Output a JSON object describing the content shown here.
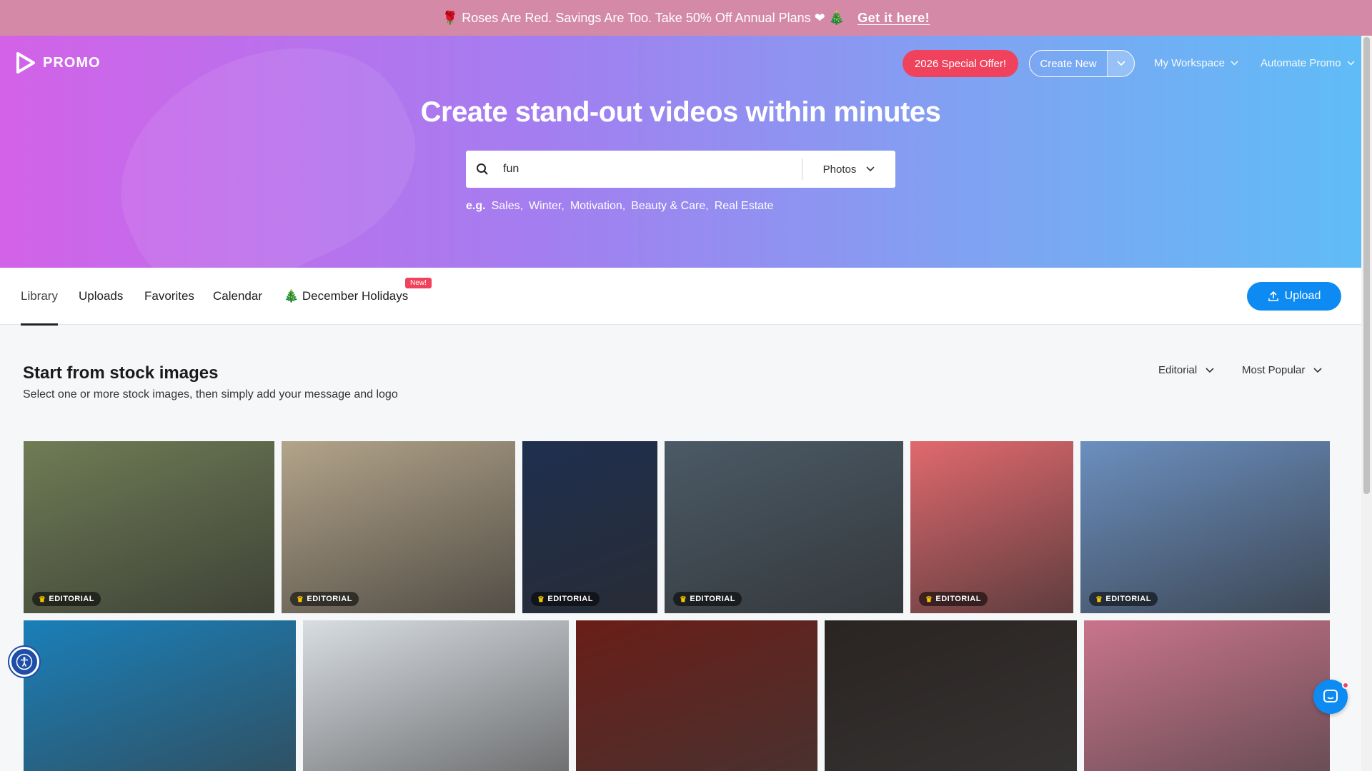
{
  "promo_banner": {
    "text": "🌹 Roses Are Red. Savings Are Too. Take 50% Off Annual Plans ❤ 🎄",
    "cta": "Get it here!"
  },
  "header": {
    "logo_text": "PROMO",
    "special_offer": "2026 Special Offer!",
    "create_new": "Create New",
    "my_workspace": "My Workspace",
    "automate_promo": "Automate Promo"
  },
  "hero": {
    "title": "Create stand-out videos within minutes",
    "search_value": "fun",
    "search_type": "Photos",
    "examples_prefix": "e.g.",
    "examples": [
      "Sales,",
      "Winter,",
      "Motivation,",
      "Beauty & Care,",
      "Real Estate"
    ]
  },
  "tabs": {
    "library": "Library",
    "uploads": "Uploads",
    "favorites": "Favorites",
    "calendar": "Calendar",
    "december_holidays": "🎄 December Holidays",
    "new_badge": "New!",
    "upload_button": "Upload"
  },
  "section": {
    "title": "Start from stock images",
    "subtitle": "Select one or more stock images, then simply add your message and logo",
    "filter_editorial": "Editorial",
    "filter_sort": "Most Popular"
  },
  "images": {
    "tag_label": "EDITORIAL",
    "row1_colors": [
      "#6f7c55",
      "#b3a48a",
      "#1f2f4f",
      "#4b5a66",
      "#e0696e",
      "#6b8fbf"
    ],
    "row2_colors": [
      "#1a7fb8",
      "#d8dde2",
      "#6a1e18",
      "#2a2422",
      "#c9748c"
    ]
  },
  "colors": {
    "accent": "#0d8bf2",
    "offer": "#f0425c",
    "banner": "#d48aa6"
  },
  "icons": {
    "search": "search-icon",
    "chevron": "chevron-down-icon",
    "upload": "upload-icon",
    "crown": "crown-icon",
    "accessibility": "accessibility-icon",
    "chat": "chat-icon"
  }
}
